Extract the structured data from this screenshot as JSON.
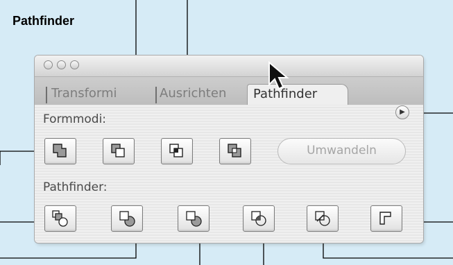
{
  "figure": {
    "title": "Pathfinder"
  },
  "window": {
    "tabs": [
      {
        "label": "Transformi"
      },
      {
        "label": "Ausrichten"
      },
      {
        "label": "Pathfinder"
      }
    ],
    "active_tab": "Pathfinder"
  },
  "shape_modes": {
    "label": "Formmodi:",
    "buttons": [
      {
        "icon": "add-to-shape-area-icon"
      },
      {
        "icon": "subtract-from-shape-area-icon"
      },
      {
        "icon": "intersect-shape-areas-icon"
      },
      {
        "icon": "exclude-overlapping-shape-areas-icon"
      }
    ],
    "convert_label": "Umwandeln"
  },
  "pathfinders": {
    "label": "Pathfinder:",
    "buttons": [
      {
        "icon": "divide-icon"
      },
      {
        "icon": "trim-icon"
      },
      {
        "icon": "merge-icon"
      },
      {
        "icon": "crop-icon"
      },
      {
        "icon": "outline-icon"
      },
      {
        "icon": "minus-back-icon"
      }
    ]
  }
}
